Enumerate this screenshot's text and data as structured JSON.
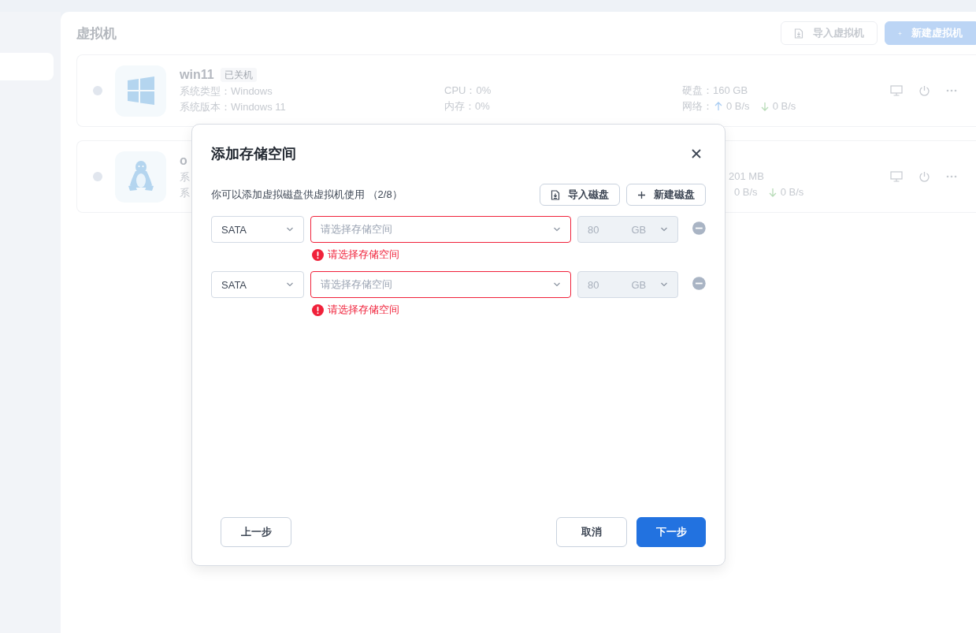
{
  "page": {
    "title": "虚拟机",
    "buttons": [
      {
        "label": "导入虚拟机",
        "kind": "outline"
      },
      {
        "label": "新建虚拟机",
        "kind": "primary"
      }
    ]
  },
  "vms": [
    {
      "name": "win11",
      "tag": "已关机",
      "kind": "windows",
      "partially_hidden": false,
      "info": [
        "系统类型：Windows",
        "系统版本：Windows 11"
      ],
      "stats": [
        "CPU：0%",
        "内存：0%"
      ],
      "disk": "硬盘：160 GB",
      "network": {
        "label": "网络：",
        "up": "0 B/s",
        "down": "0 B/s"
      }
    },
    {
      "name": "o",
      "kind": "linux",
      "partially_hidden": true,
      "info": [
        "系",
        "系"
      ],
      "disk": "201 MB",
      "network": {
        "up": "0 B/s",
        "down": "0 B/s"
      }
    }
  ],
  "dialog": {
    "title": "添加存储空间",
    "description": "你可以添加虚拟磁盘供虚拟机使用 （2/8）",
    "actions": [
      {
        "label": "导入磁盘",
        "kind": "import"
      },
      {
        "label": "新建磁盘",
        "kind": "create"
      }
    ],
    "disks": [
      {
        "bus": "SATA",
        "storage_placeholder": "请选择存储空间",
        "size": "80",
        "unit": "GB",
        "size_disabled": true,
        "error": "请选择存储空间"
      },
      {
        "bus": "SATA",
        "storage_placeholder": "请选择存储空间",
        "size": "80",
        "unit": "GB",
        "size_disabled": true,
        "error": "请选择存储空间"
      }
    ],
    "footer": [
      {
        "label": "上一步",
        "kind": "back"
      },
      {
        "label": "取消",
        "kind": "cancel"
      },
      {
        "label": "下一步",
        "kind": "next"
      }
    ]
  }
}
